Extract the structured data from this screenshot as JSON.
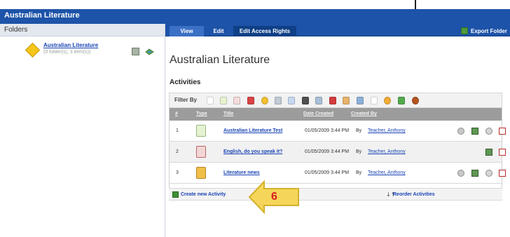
{
  "window": {
    "title": "Australian Literature"
  },
  "sidebar": {
    "header": "Folders",
    "folder": {
      "name": "Australian Literature",
      "count": "(0 folder(s), 3 item(s))"
    }
  },
  "tabs": [
    {
      "label": "View",
      "active": true
    },
    {
      "label": "Edit",
      "active": false
    },
    {
      "label": "Edit Access Rights",
      "active": false
    }
  ],
  "toolbar": {
    "export_label": "Export Folder"
  },
  "main": {
    "page_title": "Australian Literature",
    "section_title": "Activities",
    "filter_label": "Filter By",
    "table": {
      "columns": [
        "#",
        "Type",
        "Title",
        "Date Created",
        "Created By"
      ],
      "rows": [
        {
          "index": "1",
          "title": "Australian Literature Test",
          "date": "01/05/2009 3:44 PM",
          "by": "By",
          "teacher": "Teacher, Anthony"
        },
        {
          "index": "2",
          "title": "English, do you speak it?",
          "date": "01/05/2009 3:44 PM",
          "by": "By",
          "teacher": "Teacher, Anthony"
        },
        {
          "index": "3",
          "title": "Literature news",
          "date": "01/05/2009 3:44 PM",
          "by": "By",
          "teacher": "Teacher, Anthony"
        }
      ]
    },
    "footer": {
      "create_label": "Create new Activity",
      "reorder_label": "Reorder Activities"
    }
  },
  "callout": {
    "number": "6"
  },
  "colors": {
    "accent": "#1d53a8",
    "link": "#1a44b5",
    "table_header": "#9c9c9c",
    "callout_fill": "#f5d65a",
    "callout_text": "#d81e1e"
  },
  "icons": [
    "folder-diamond-icon",
    "folder-settings-icon",
    "folder-stack-icon",
    "export-icon",
    "create-plus-icon",
    "reorder-icon"
  ]
}
